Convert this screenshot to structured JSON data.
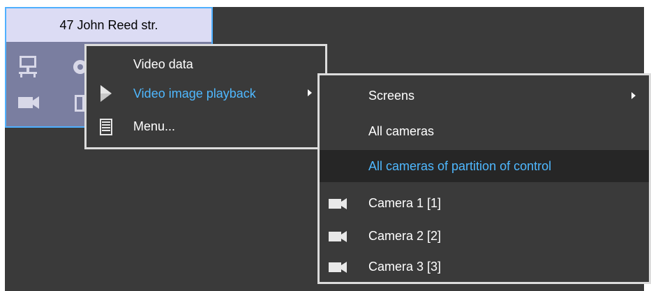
{
  "tile": {
    "title": "47 John Reed str.",
    "icons": [
      "network-icon",
      "gear-icon",
      "camera-icon",
      "door-icon"
    ]
  },
  "menu_main": {
    "items": [
      {
        "label": "Video data",
        "icon": "none"
      },
      {
        "label": "Video image playback",
        "icon": "play-arrow-icon",
        "active": true,
        "submenu": true
      },
      {
        "label": "Menu...",
        "icon": "menu-list-icon"
      }
    ]
  },
  "menu_sub": {
    "items": [
      {
        "label": "Screens",
        "submenu": true
      },
      {
        "label": "All cameras"
      },
      {
        "label": "All cameras of partition of control",
        "highlighted": true
      },
      {
        "label": "Camera 1 [1]",
        "icon": "camera-icon"
      },
      {
        "label": "Camera 2 [2]",
        "icon": "camera-icon"
      },
      {
        "label": "Camera 3 [3]",
        "icon": "camera-icon"
      }
    ]
  },
  "colors": {
    "accent": "#4fb8ff",
    "background": "#3a3a3a",
    "tile_body": "#7a7ea0",
    "tile_header": "#dcdcf4",
    "highlight": "#262626"
  }
}
